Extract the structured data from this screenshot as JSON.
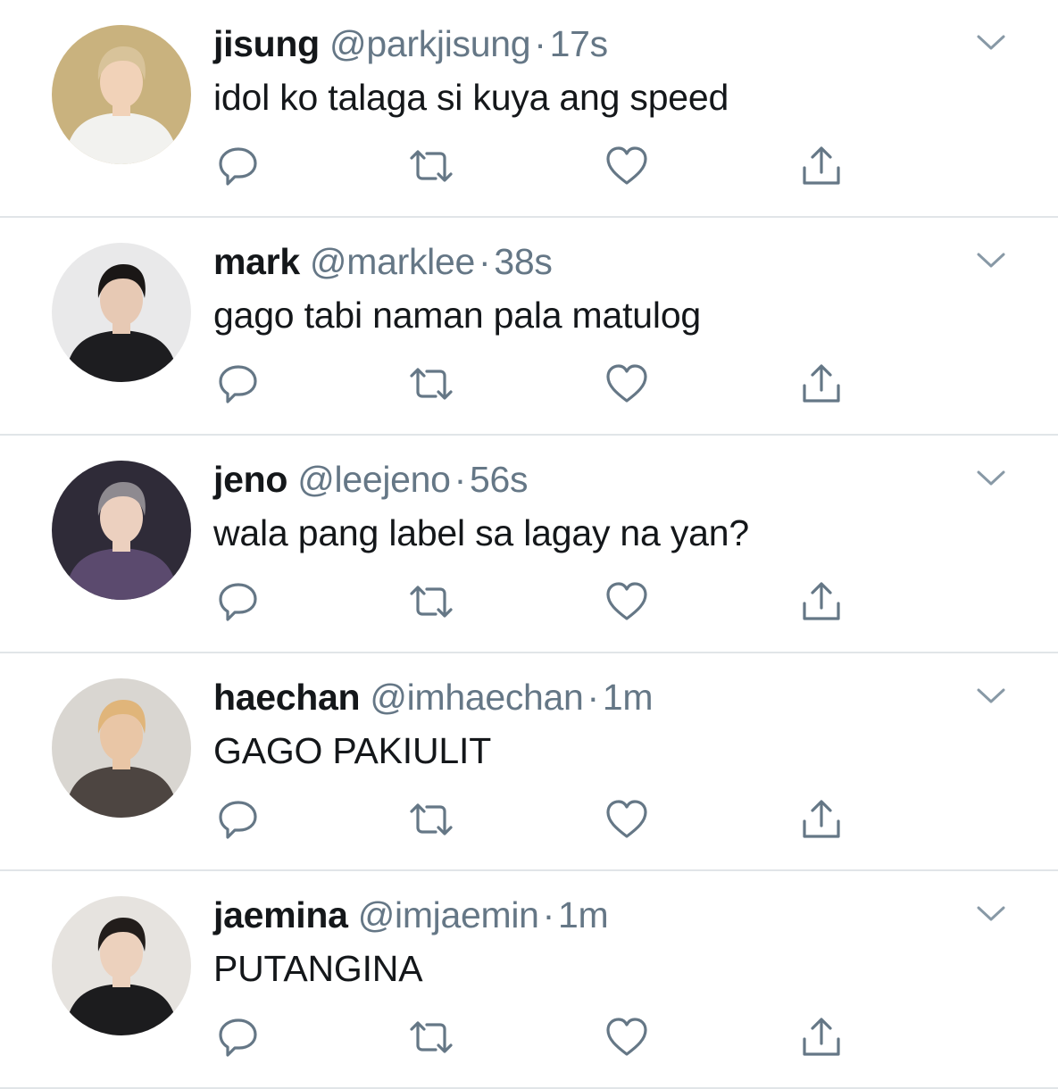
{
  "tweets": [
    {
      "name": "jisung",
      "handle": "@parkjisung",
      "separator": "·",
      "time": "17s",
      "text": "idol ko talaga si kuya ang speed",
      "avatar_colors": {
        "bg": "#c9b27e",
        "shirt": "#f2f2ef",
        "hair": "#d8c39a",
        "skin": "#f1d2b8"
      }
    },
    {
      "name": "mark",
      "handle": "@marklee",
      "separator": "·",
      "time": "38s",
      "text": "gago tabi naman pala matulog",
      "avatar_colors": {
        "bg": "#e9e9ea",
        "shirt": "#1d1d20",
        "hair": "#1a1716",
        "skin": "#e7c9b4"
      }
    },
    {
      "name": "jeno",
      "handle": "@leejeno",
      "separator": "·",
      "time": "56s",
      "text": "wala pang label sa lagay na yan?",
      "avatar_colors": {
        "bg": "#2f2b38",
        "shirt": "#5b4a6e",
        "hair": "#8e8a90",
        "skin": "#ecd0bf"
      }
    },
    {
      "name": "haechan",
      "handle": "@imhaechan",
      "separator": "·",
      "time": "1m",
      "text": "GAGO PAKIULIT",
      "avatar_colors": {
        "bg": "#d9d6d1",
        "shirt": "#4d4541",
        "hair": "#e0b57a",
        "skin": "#e9c6a6"
      }
    },
    {
      "name": "jaemina",
      "handle": "@imjaemin",
      "separator": "·",
      "time": "1m",
      "text": "PUTANGINA",
      "avatar_colors": {
        "bg": "#e6e3df",
        "shirt": "#1c1c1e",
        "hair": "#221d1b",
        "skin": "#ecd1bd"
      }
    }
  ],
  "icons": {
    "reply": "reply-icon",
    "retweet": "retweet-icon",
    "like": "heart-icon",
    "share": "share-icon",
    "menu": "chevron-down-icon"
  },
  "colors": {
    "text": "#14171a",
    "secondary": "#657786",
    "divider": "#e1e5e8",
    "icon": "#657786"
  }
}
